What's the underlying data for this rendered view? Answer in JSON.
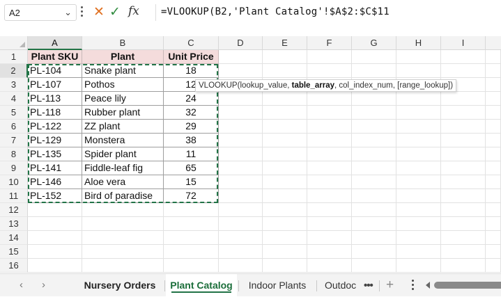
{
  "formula_bar": {
    "name_box": "A2",
    "cancel_icon": "✕",
    "enter_icon": "✓",
    "fx_icon": "fx",
    "formula": "=VLOOKUP(B2,'Plant Catalog'!$A$2:$C$11"
  },
  "columns": [
    "A",
    "B",
    "C",
    "D",
    "E",
    "F",
    "G",
    "H",
    "I"
  ],
  "rows": [
    "1",
    "2",
    "3",
    "4",
    "5",
    "6",
    "7",
    "8",
    "9",
    "10",
    "11",
    "12",
    "13",
    "14",
    "15",
    "16"
  ],
  "table": {
    "headers": [
      "Plant SKU",
      "Plant",
      "Unit Price"
    ],
    "rows": [
      [
        "PL-104",
        "Snake plant",
        "18"
      ],
      [
        "PL-107",
        "Pothos",
        "12"
      ],
      [
        "PL-113",
        "Peace lily",
        "24"
      ],
      [
        "PL-118",
        "Rubber plant",
        "32"
      ],
      [
        "PL-122",
        "ZZ plant",
        "29"
      ],
      [
        "PL-129",
        "Monstera",
        "38"
      ],
      [
        "PL-135",
        "Spider plant",
        "11"
      ],
      [
        "PL-141",
        "Fiddle-leaf fig",
        "65"
      ],
      [
        "PL-146",
        "Aloe vera",
        "15"
      ],
      [
        "PL-152",
        "Bird of paradise",
        "72"
      ]
    ]
  },
  "tooltip": {
    "fn": "VLOOKUP(",
    "arg1": "lookup_value, ",
    "arg2": "table_array",
    "rest": ", col_index_num, [range_lookup])"
  },
  "tabs": {
    "prev": "‹",
    "next": "›",
    "items": [
      "Nursery Orders",
      "Plant Catalog",
      "Indoor Plants",
      "Outdoc"
    ],
    "active_index": 1,
    "more": "•••",
    "add": "+"
  },
  "colors": {
    "accent": "#217346",
    "header_fill": "#f4dcdc"
  }
}
